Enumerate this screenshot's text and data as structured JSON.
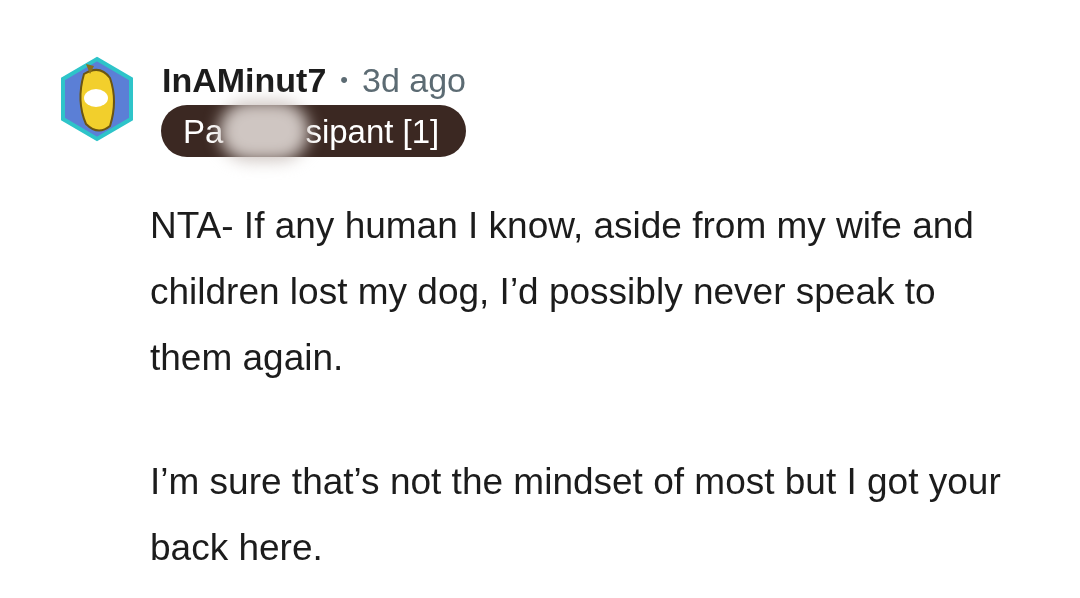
{
  "comment": {
    "username": "InAMinut7",
    "separator": "•",
    "time": "3d ago",
    "flair": {
      "visible_start": "Pa",
      "visible_end": "sipant [1]",
      "redacted": true
    },
    "paragraphs": [
      "NTA- If any human I know, aside from my wife and children lost my dog, I’d possibly never speak to them again.",
      "I’m sure that’s not the mindset of most but I got your back here."
    ]
  }
}
